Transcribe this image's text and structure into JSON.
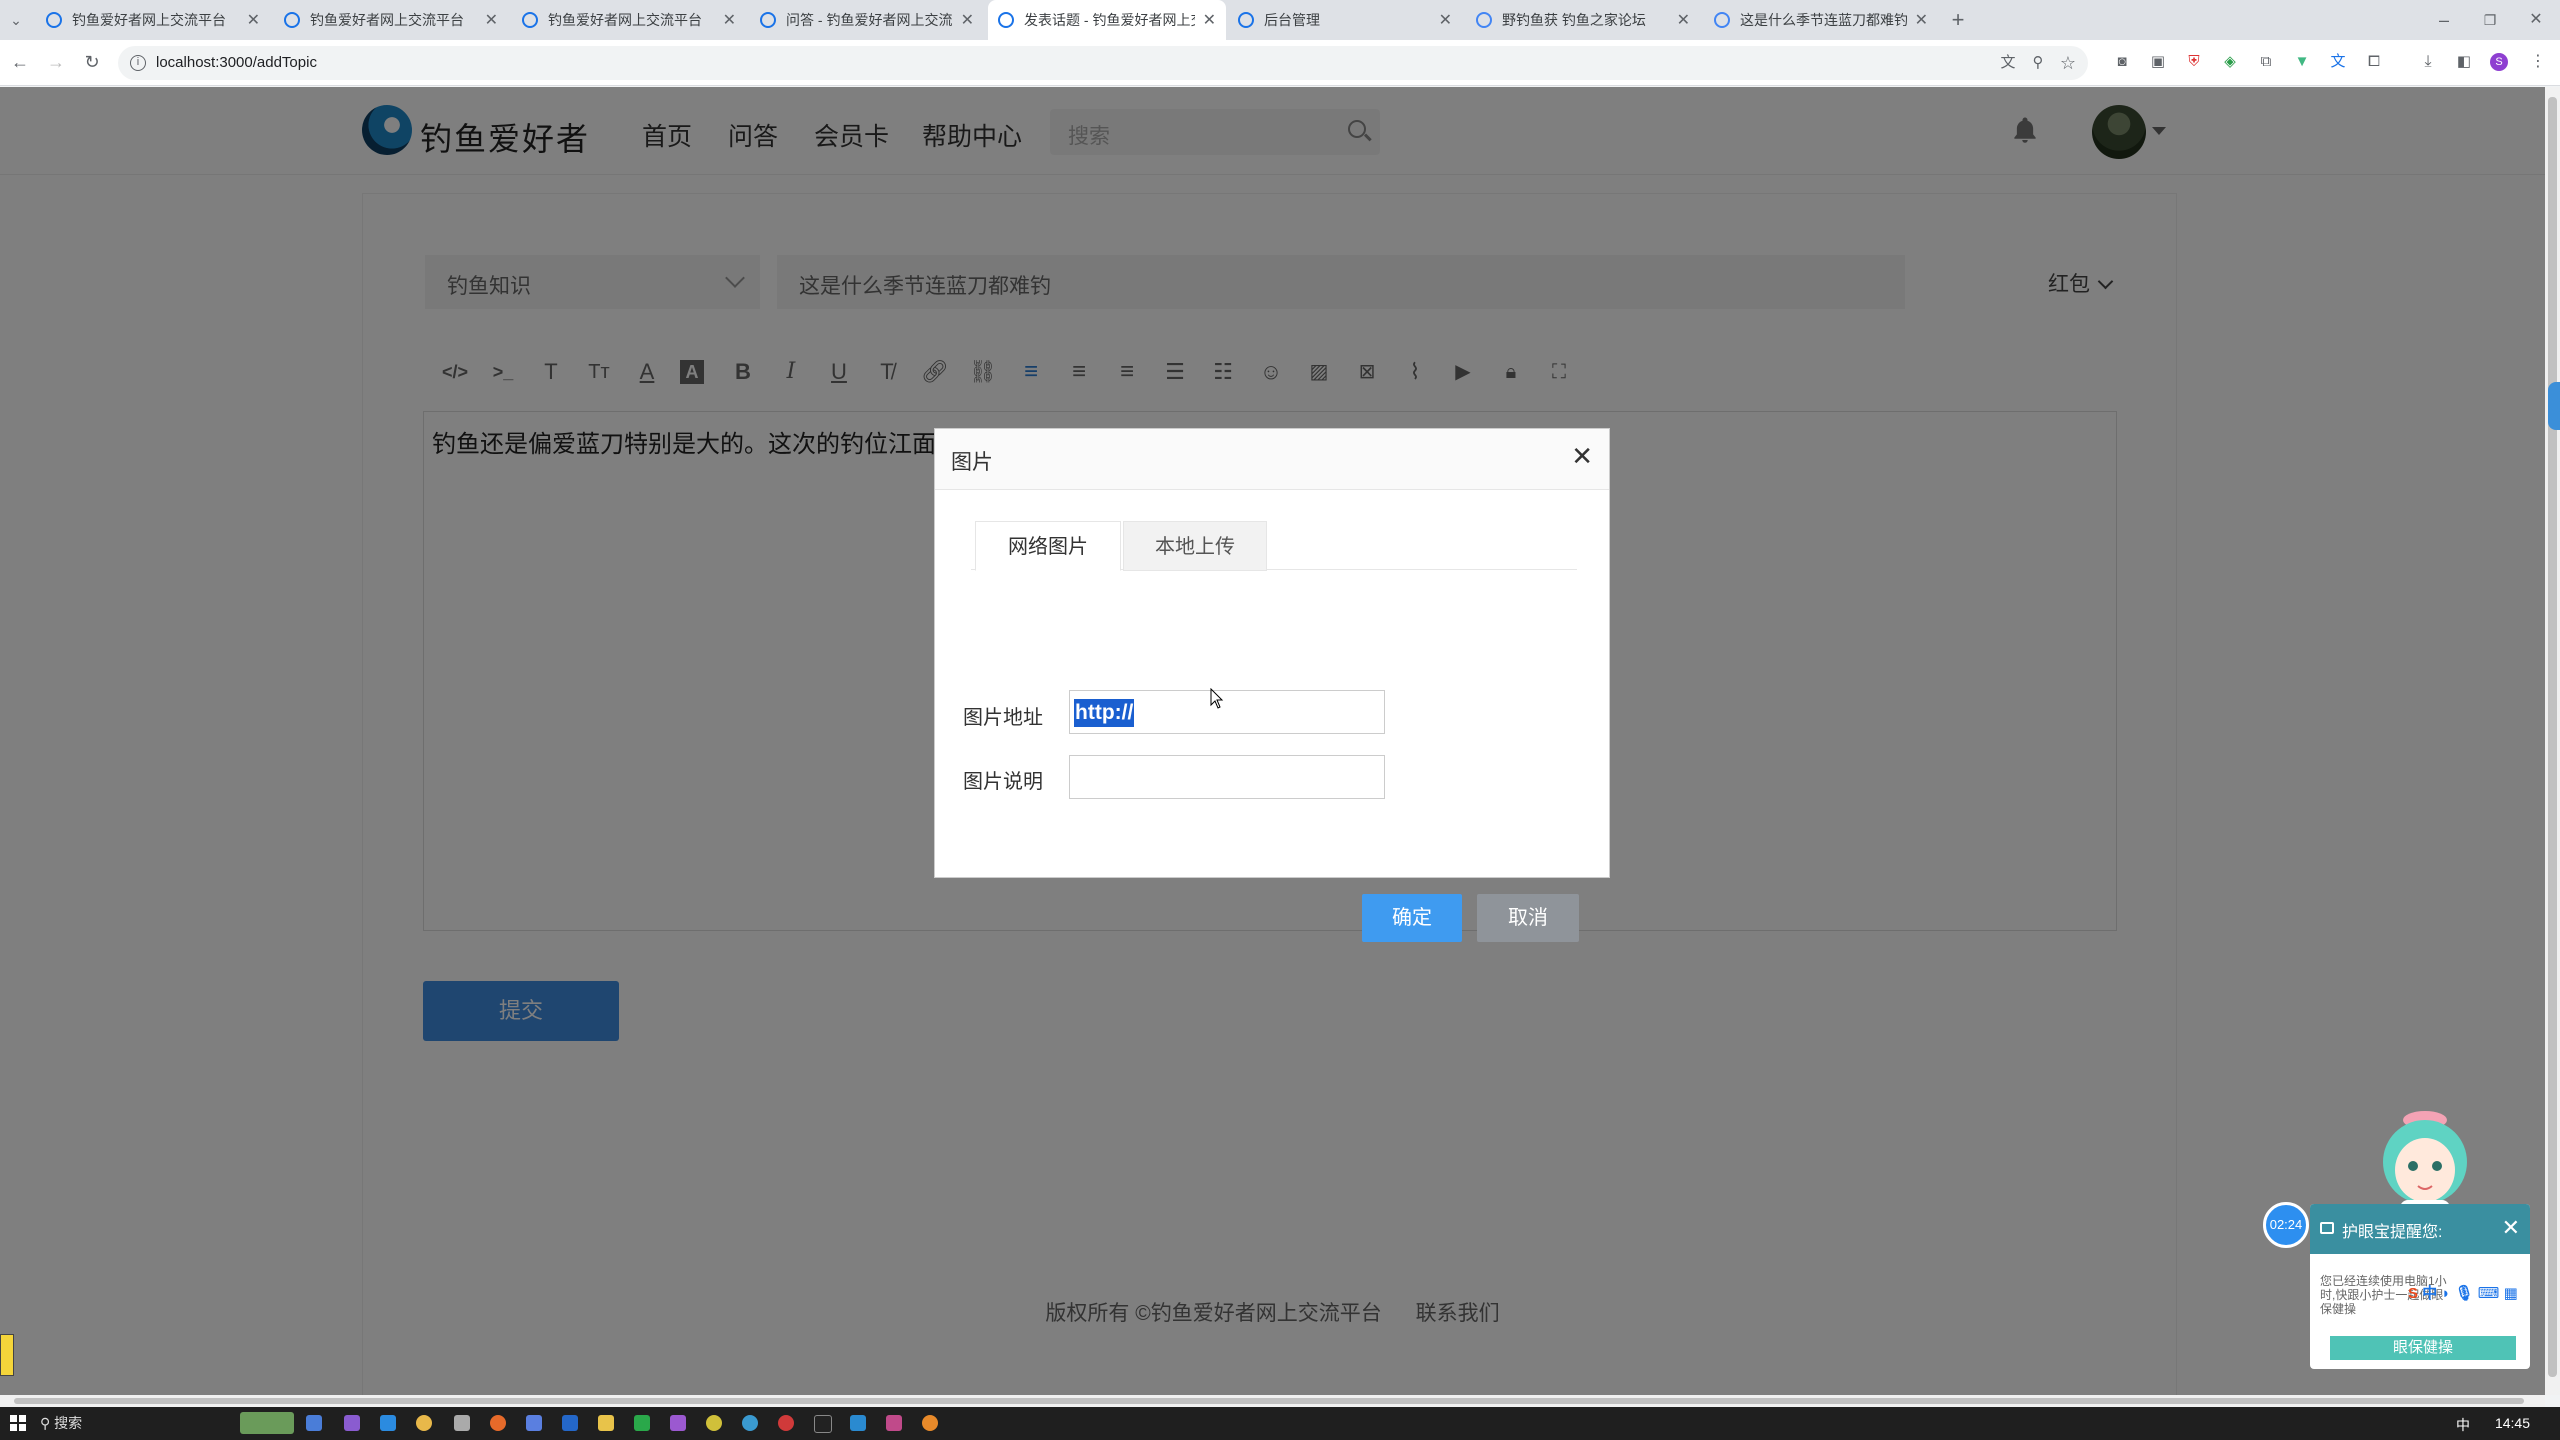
{
  "browser": {
    "tabs": [
      {
        "title": "钓鱼爱好者网上交流平台"
      },
      {
        "title": "钓鱼爱好者网上交流平台"
      },
      {
        "title": "钓鱼爱好者网上交流平台"
      },
      {
        "title": "问答 - 钓鱼爱好者网上交流平台"
      },
      {
        "title": "发表话题 - 钓鱼爱好者网上交流"
      },
      {
        "title": "后台管理"
      },
      {
        "title": "野钓鱼获 钓鱼之家论坛"
      },
      {
        "title": "这是什么季节连蓝刀都难钓 - 钓"
      }
    ],
    "url": "localhost:3000/addTopic",
    "profile_initial": "S"
  },
  "site": {
    "logo_text": "钓鱼爱好者",
    "nav": [
      "首页",
      "问答",
      "会员卡",
      "帮助中心"
    ],
    "search_placeholder": "搜索"
  },
  "form": {
    "category": "钓鱼知识",
    "title_value": "这是什么季节连蓝刀都难钓",
    "reward": "红包",
    "content": "钓鱼还是偏爱蓝刀特别是大的。这次的钓位江面宽阔水又深不见底，蓝刀居然没有，赤眼都抽来了蓝刀都不来。",
    "submit_label": "提交"
  },
  "toolbar_icons": [
    "code-icon",
    "terminal-icon",
    "text-icon",
    "font-size-icon",
    "font-color-icon",
    "background-color-icon",
    "bold-icon",
    "italic-icon",
    "underline-icon",
    "clear-format-icon",
    "link-icon",
    "unlink-icon",
    "align-left-icon",
    "align-center-icon",
    "align-right-icon",
    "ordered-list-icon",
    "unordered-list-icon",
    "emoji-icon",
    "image-icon",
    "image-remove-icon",
    "attachment-icon",
    "video-icon",
    "lock-icon",
    "fullscreen-icon"
  ],
  "modal": {
    "title": "图片",
    "tabs": [
      "网络图片",
      "本地上传"
    ],
    "url_label": "图片地址",
    "url_value": "http://",
    "desc_label": "图片说明",
    "desc_value": "",
    "ok_label": "确定",
    "cancel_label": "取消"
  },
  "footer": {
    "copyright": "版权所有 ©钓鱼爱好者网上交流平台",
    "contact": "联系我们"
  },
  "eye_care": {
    "timer": "02:24",
    "title": "护眼宝提醒您:",
    "message": "您已经连续使用电脑1小时,快跟小护士一起做眼保健操",
    "button": "眼保健操",
    "ime": "中"
  },
  "taskbar": {
    "search": "搜索",
    "ime": "中",
    "time": "14:45"
  }
}
